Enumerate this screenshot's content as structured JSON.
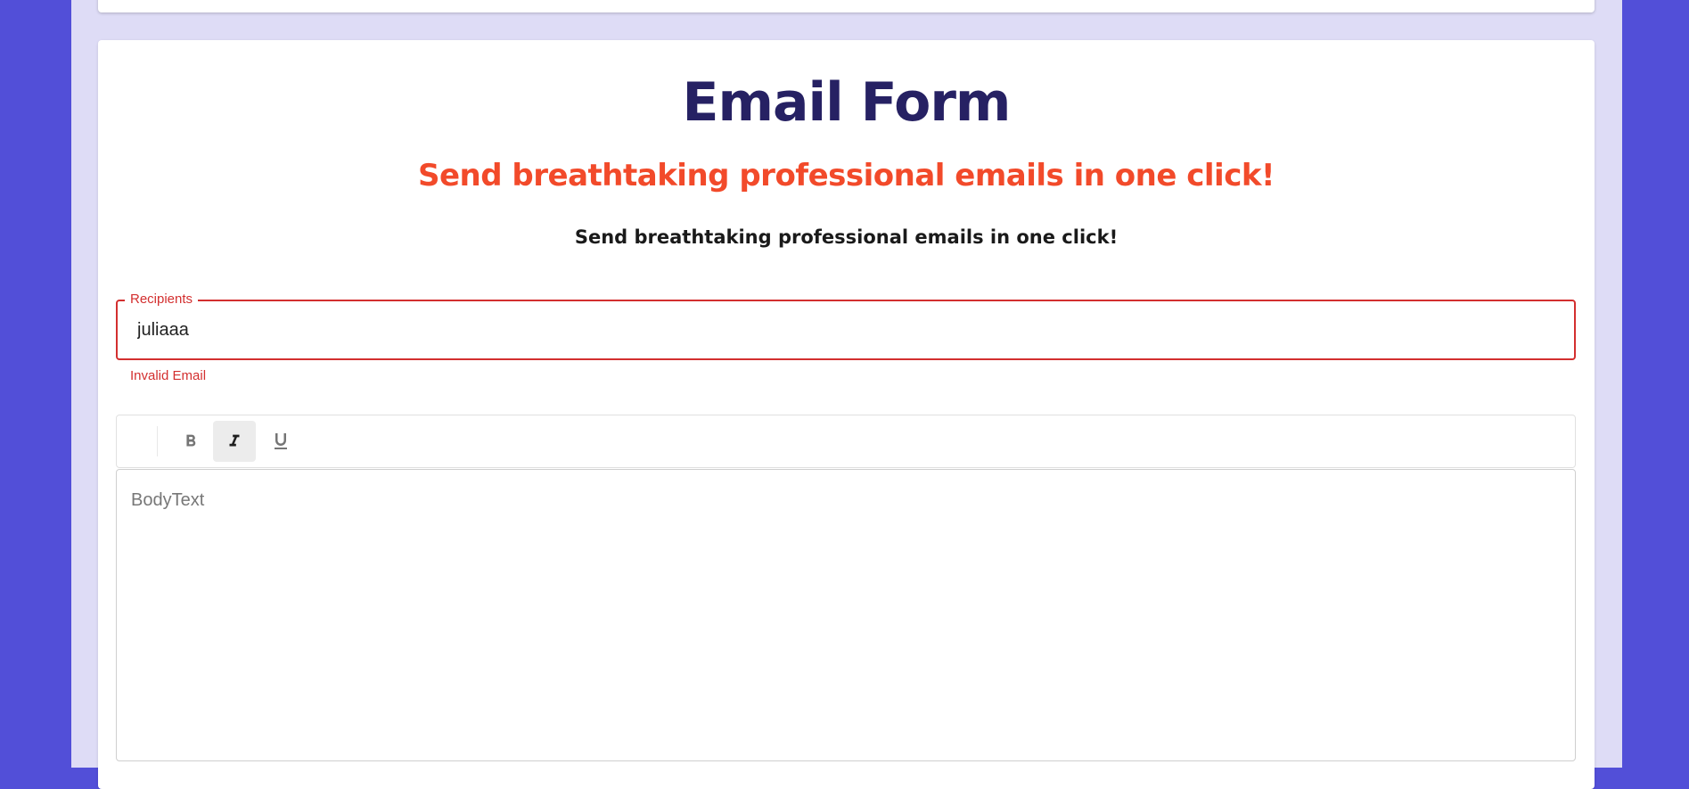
{
  "header": {
    "title": "Email Form",
    "subtitle": "Send breathtaking professional emails in one click!",
    "tagline": "Send breathtaking professional emails in one click!"
  },
  "recipients": {
    "label": "Recipients",
    "value": "juliaaa",
    "error": "Invalid Email"
  },
  "toolbar": {
    "bold_icon": "bold-icon",
    "italic_icon": "italic-icon",
    "underline_icon": "underline-icon",
    "active": "italic"
  },
  "editor": {
    "placeholder": "BodyText"
  },
  "colors": {
    "background": "#524fd8",
    "panel": "#dedcf6",
    "title": "#262163",
    "subtitle": "#f24a2a",
    "error": "#d32f2f"
  }
}
